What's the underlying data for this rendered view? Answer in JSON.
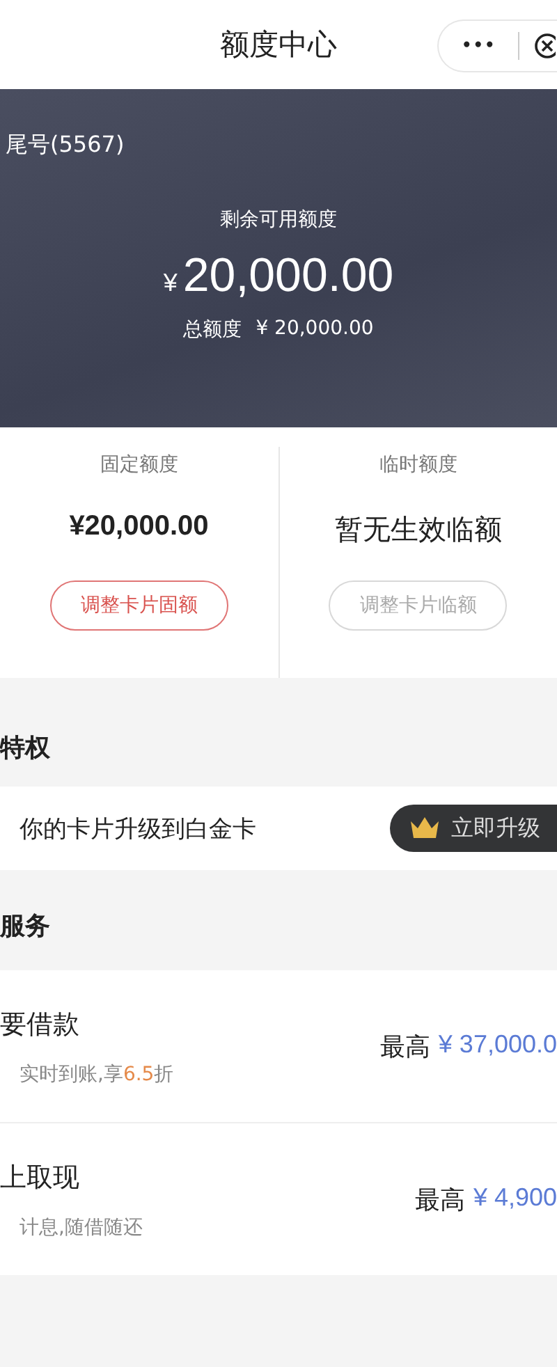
{
  "nav_bar": {
    "title": "额度中心",
    "more": "•••"
  },
  "card": {
    "tail_number": "尾号(5567)",
    "available_label": "剩余可用额度",
    "currency": "¥",
    "available_amount": "20,000.00",
    "total_label": "总额度",
    "total_amount": "¥ 20,000.00"
  },
  "limits": [
    {
      "label": "固定额度",
      "value": "¥20,000.00",
      "kind": "amount",
      "button": {
        "label": "调整卡片固额",
        "disabled": false
      }
    },
    {
      "label": "临时额度",
      "value": "暂无生效临额",
      "kind": "text",
      "button": {
        "label": "调整卡片临额",
        "disabled": true
      }
    }
  ],
  "privileges": {
    "heading": "特权",
    "text": "你的卡片升级到白金卡",
    "upgrade_button": "立即升级"
  },
  "services": {
    "heading": "服务",
    "items": [
      {
        "title": "要借款",
        "subtitle": [
          {
            "text": "实时到账,享",
            "highlight": false
          },
          {
            "text": "6.5",
            "highlight": true
          },
          {
            "text": "折",
            "highlight": false
          }
        ],
        "max_label": "最高",
        "max_amount": "¥ 37,000.0"
      },
      {
        "title": "上取现",
        "subtitle": [
          {
            "text": "计息,随借随还",
            "highlight": false
          }
        ],
        "max_label": "最高",
        "max_amount": "¥ 4,900"
      }
    ]
  }
}
